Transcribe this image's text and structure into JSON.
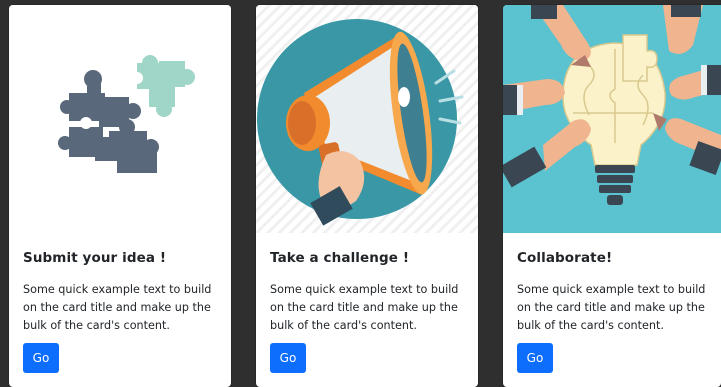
{
  "colors": {
    "page_background": "#2f2f2f",
    "card_background": "#ffffff",
    "button": "#0d6efd",
    "puzzle_dark": "#59687a",
    "puzzle_mint": "#9fd6c7",
    "megaphone_circle": "#3a98a6",
    "megaphone_orange": "#f28b2e",
    "collab_background": "#5bc2cf",
    "bulb_cream": "#fbf2c9"
  },
  "cards": [
    {
      "title": "Submit your idea !",
      "text": "Some quick example text to build on the card title and make up the bulk of the card's content.",
      "button_label": "Go",
      "icon": "puzzle-pieces-icon"
    },
    {
      "title": "Take a challenge !",
      "text": "Some quick example text to build on the card title and make up the bulk of the card's content.",
      "button_label": "Go",
      "icon": "megaphone-icon"
    },
    {
      "title": "Collaborate!",
      "text": "Some quick example text to build on the card title and make up the bulk of the card's content.",
      "button_label": "Go",
      "icon": "lightbulb-puzzle-hands-icon"
    }
  ]
}
